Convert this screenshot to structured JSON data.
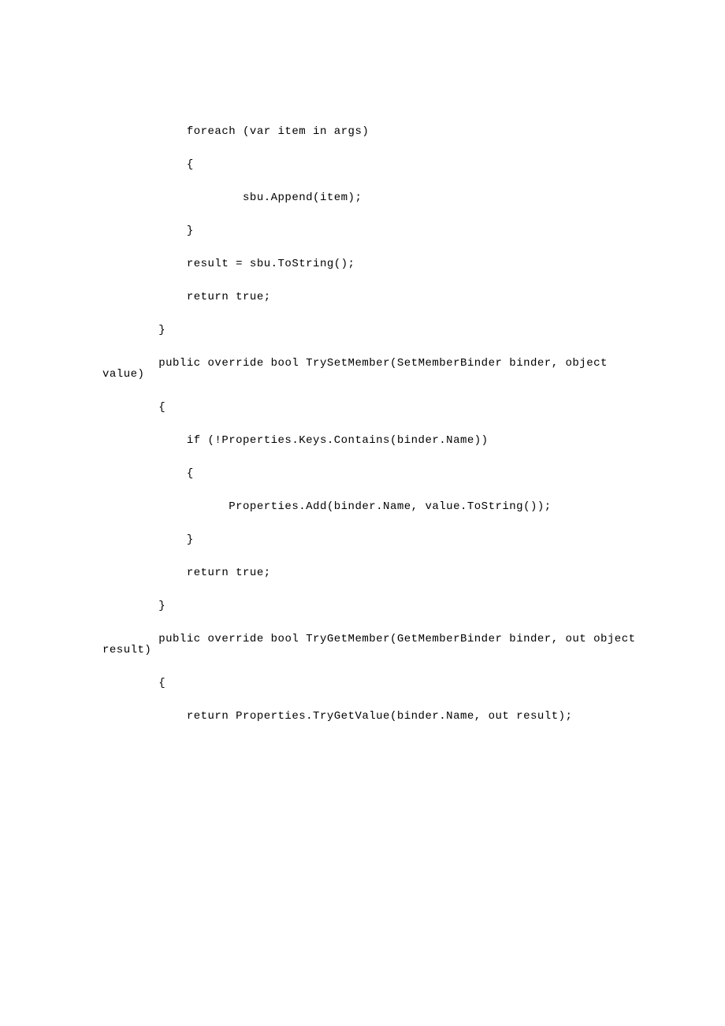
{
  "lines": [
    "            foreach (var item in args)",
    "            {",
    "                    sbu.Append(item);",
    "            }",
    "",
    "            result = sbu.ToString();",
    "            return true;",
    "",
    "        }",
    "",
    "        public override bool TrySetMember(SetMemberBinder binder, object value)",
    "        {",
    "            if (!Properties.Keys.Contains(binder.Name))",
    "            {",
    "                  Properties.Add(binder.Name, value.ToString());",
    "            }",
    "            return true;",
    "        }",
    "",
    "        public override bool TryGetMember(GetMemberBinder binder, out object result)",
    "        {",
    "            return Properties.TryGetValue(binder.Name, out result);"
  ]
}
